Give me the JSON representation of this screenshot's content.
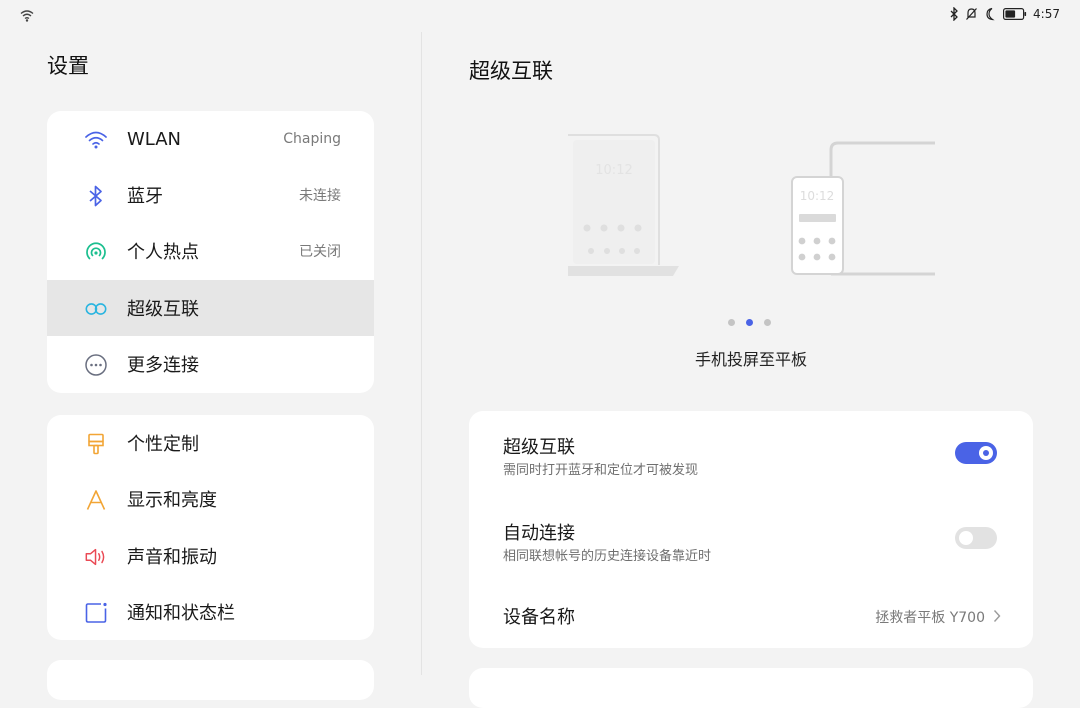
{
  "status_bar": {
    "time": "4:57",
    "icons": [
      "wifi-icon",
      "bluetooth-icon",
      "silent-icon",
      "moon-icon",
      "battery-icon"
    ],
    "battery_fill": 0.6
  },
  "settings": {
    "title": "设置",
    "groups": [
      {
        "items": [
          {
            "label": "WLAN",
            "value": "Chaping",
            "icon": "wifi-icon",
            "color": "#4a63e6"
          },
          {
            "label": "蓝牙",
            "value": "未连接",
            "icon": "bluetooth-icon",
            "color": "#4a63e6"
          },
          {
            "label": "个人热点",
            "value": "已关闭",
            "icon": "hotspot-icon",
            "color": "#1bbf8f"
          },
          {
            "label": "超级互联",
            "value": "",
            "icon": "super-link-icon",
            "color": "#2bb5e0",
            "active": true
          },
          {
            "label": "更多连接",
            "value": "",
            "icon": "more-icon",
            "color": "#6a6f80"
          }
        ]
      },
      {
        "items": [
          {
            "label": "个性定制",
            "icon": "brush-icon",
            "color": "#f2a535"
          },
          {
            "label": "显示和亮度",
            "icon": "display-icon",
            "color": "#f2a535"
          },
          {
            "label": "声音和振动",
            "icon": "speaker-icon",
            "color": "#ea4a55"
          },
          {
            "label": "通知和状态栏",
            "icon": "notification-icon",
            "color": "#4a63e6"
          }
        ]
      }
    ]
  },
  "detail": {
    "title": "超级互联",
    "illustration": {
      "clock_text": "10:12"
    },
    "carousel": {
      "count": 3,
      "active_index": 1
    },
    "caption": "手机投屏至平板",
    "rows": [
      {
        "title": "超级互联",
        "subtitle": "需同时打开蓝牙和定位才可被发现",
        "toggle": true
      },
      {
        "title": "自动连接",
        "subtitle": "相同联想帐号的历史连接设备靠近时",
        "toggle": false
      },
      {
        "title": "设备名称",
        "value": "拯救者平板 Y700"
      }
    ]
  },
  "colors": {
    "accent": "#4a63e6",
    "background": "#f3f3f3",
    "card": "#ffffff"
  }
}
